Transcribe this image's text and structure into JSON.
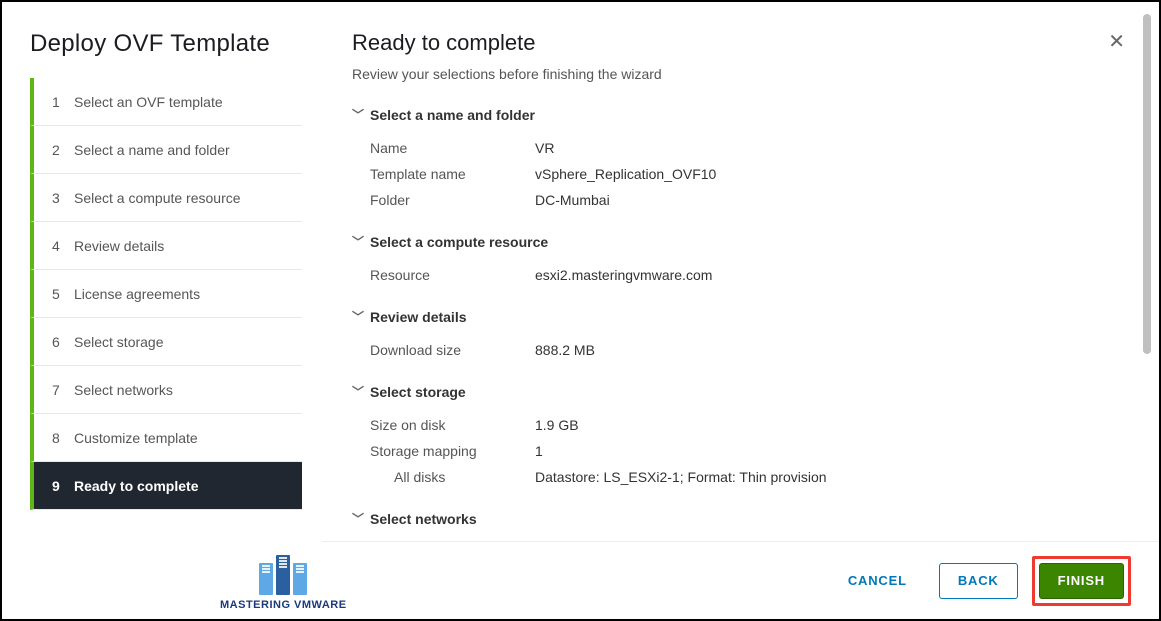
{
  "wizard": {
    "title": "Deploy OVF Template",
    "steps": [
      {
        "num": "1",
        "label": "Select an OVF template"
      },
      {
        "num": "2",
        "label": "Select a name and folder"
      },
      {
        "num": "3",
        "label": "Select a compute resource"
      },
      {
        "num": "4",
        "label": "Review details"
      },
      {
        "num": "5",
        "label": "License agreements"
      },
      {
        "num": "6",
        "label": "Select storage"
      },
      {
        "num": "7",
        "label": "Select networks"
      },
      {
        "num": "8",
        "label": "Customize template"
      },
      {
        "num": "9",
        "label": "Ready to complete"
      }
    ]
  },
  "page": {
    "title": "Ready to complete",
    "subtitle": "Review your selections before finishing the wizard"
  },
  "sections": {
    "name_folder": {
      "header": "Select a name and folder",
      "name_label": "Name",
      "name_value": "VR",
      "template_label": "Template name",
      "template_value": "vSphere_Replication_OVF10",
      "folder_label": "Folder",
      "folder_value": "DC-Mumbai"
    },
    "compute": {
      "header": "Select a compute resource",
      "resource_label": "Resource",
      "resource_value": "esxi2.masteringvmware.com"
    },
    "review": {
      "header": "Review details",
      "download_label": "Download size",
      "download_value": "888.2 MB"
    },
    "storage": {
      "header": "Select storage",
      "size_label": "Size on disk",
      "size_value": "1.9 GB",
      "mapping_label": "Storage mapping",
      "mapping_value": "1",
      "alldisks_label": "All disks",
      "alldisks_value": "Datastore: LS_ESXi2-1; Format: Thin provision"
    },
    "networks": {
      "header": "Select networks"
    }
  },
  "footer": {
    "cancel": "CANCEL",
    "back": "BACK",
    "finish": "FINISH"
  },
  "watermark": "MASTERING VMWARE"
}
